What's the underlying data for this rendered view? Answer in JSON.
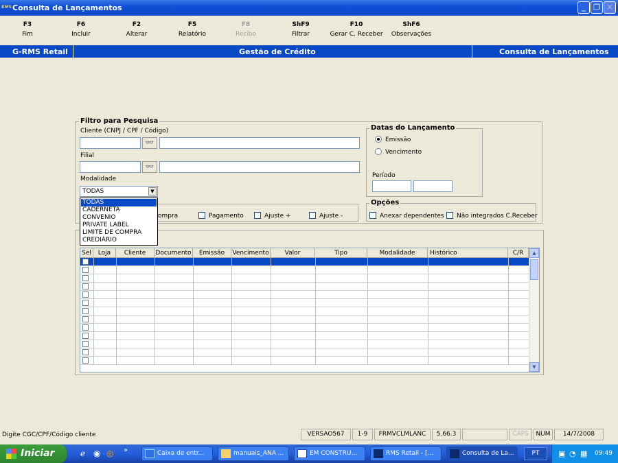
{
  "window": {
    "title": "Consulta de Lançamentos",
    "app_icon": "RMS"
  },
  "fkeys": [
    {
      "key": "F3",
      "label": "Fim",
      "enabled": true
    },
    {
      "key": "F6",
      "label": "Incluir",
      "enabled": true
    },
    {
      "key": "F2",
      "label": "Alterar",
      "enabled": true
    },
    {
      "key": "F5",
      "label": "Relatório",
      "enabled": true
    },
    {
      "key": "F8",
      "label": "Recibo",
      "enabled": false
    },
    {
      "key": "ShF9",
      "label": "Filtrar",
      "enabled": true
    },
    {
      "key": "F10",
      "label": "Gerar C. Receber",
      "enabled": true
    },
    {
      "key": "ShF6",
      "label": "Observações",
      "enabled": true
    }
  ],
  "header": {
    "left": "G-RMS Retail",
    "center": "Gestão de Crédito",
    "right": "Consulta de Lançamentos"
  },
  "filter": {
    "title": "Filtro para Pesquisa",
    "cliente_label": "Cliente (CNPJ / CPF / Código)",
    "filial_label": "Filial",
    "modalidade_label": "Modalidade",
    "modalidade_value": "TODAS",
    "modalidade_options": [
      "TODAS",
      "CADERNETA",
      "CONVENIO",
      "PRIVATE LABEL",
      "LIMITE DE COMPRA",
      "CREDIÁRIO"
    ]
  },
  "tipos": {
    "compra": "ompra",
    "pagamento": "Pagamento",
    "ajuste_mais": "Ajuste +",
    "ajuste_menos": "Ajuste -"
  },
  "datas": {
    "title": "Datas do Lançamento",
    "emissao": "Emissão",
    "vencimento": "Vencimento",
    "periodo": "Período"
  },
  "opcoes": {
    "title": "Opções",
    "anexar": "Anexar dependentes",
    "nao_integrados": "Não integrados C.Receber"
  },
  "grid": {
    "columns": [
      "Sel",
      "Loja",
      "Cliente",
      "Documento",
      "Emissão",
      "Vencimento",
      "Valor",
      "Tipo",
      "Modalidade",
      "Histórico",
      "C/R"
    ],
    "row_count": 13
  },
  "status": {
    "message": "Digite CGC/CPF/Código cliente",
    "version": "VERSAO567",
    "range": "1-9",
    "form": "FRMVCLMLANC",
    "build": "5.66.3",
    "caps": "CAPS",
    "num": "NUM",
    "date": "14/7/2008"
  },
  "taskbar": {
    "start": "Iniciar",
    "items": [
      "Caixa de entr...",
      "manuais_ANA ...",
      "EM CONSTRU...",
      "RMS Retail - [...",
      "Consulta de La..."
    ],
    "lang": "PT",
    "time": "09:49"
  }
}
